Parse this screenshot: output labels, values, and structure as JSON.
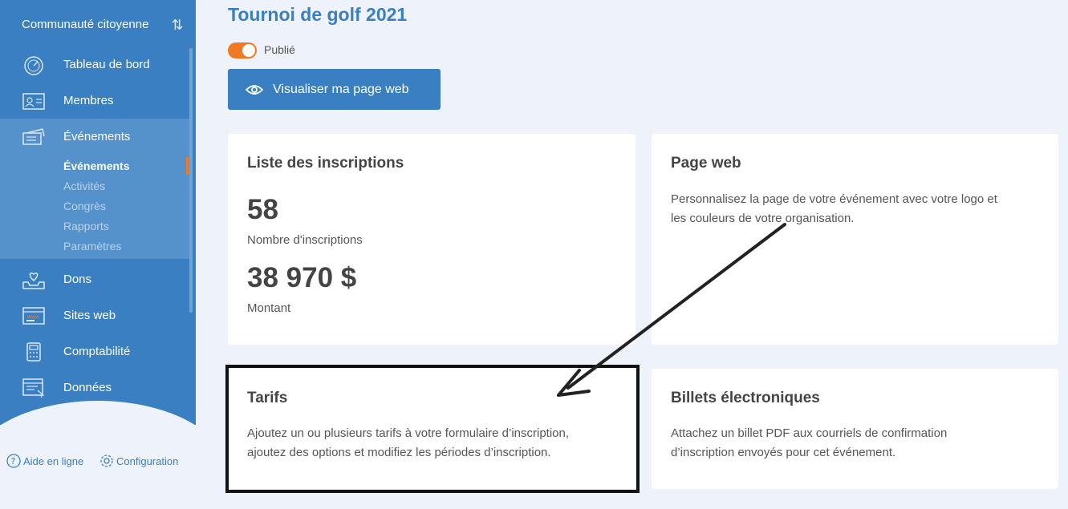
{
  "sidebar": {
    "org_name": "Communauté citoyenne",
    "items": [
      {
        "label": "Tableau de bord",
        "icon": "dashboard-gauge-icon"
      },
      {
        "label": "Membres",
        "icon": "members-card-icon"
      },
      {
        "label": "Événements",
        "icon": "tickets-icon"
      },
      {
        "label": "Dons",
        "icon": "donation-heart-icon"
      },
      {
        "label": "Sites web",
        "icon": "website-icon"
      },
      {
        "label": "Comptabilité",
        "icon": "calculator-icon"
      },
      {
        "label": "Données",
        "icon": "data-report-icon"
      }
    ],
    "subitems": [
      "Événements",
      "Activités",
      "Congrès",
      "Rapports",
      "Paramètres"
    ],
    "help_label": "Aide en ligne",
    "config_label": "Configuration"
  },
  "main": {
    "title": "Tournoi de golf 2021",
    "published_label": "Publié",
    "view_button": "Visualiser ma page web",
    "cards": {
      "registrations": {
        "title": "Liste des inscriptions",
        "count": "58",
        "count_label": "Nombre d'inscriptions",
        "amount": "38 970 $",
        "amount_label": "Montant"
      },
      "webpage": {
        "title": "Page web",
        "text_line1": "Personnalisez la page de votre événement avec votre logo et",
        "text_line2": "les couleurs de votre organisation."
      },
      "rates": {
        "title": "Tarifs",
        "text_line1": "Ajoutez un ou plusieurs tarifs à votre formulaire d’inscription,",
        "text_line2": "ajoutez des options et modifiez les périodes d’inscription."
      },
      "tickets": {
        "title": "Billets électroniques",
        "text_line1": "Attachez un billet PDF aux courriels de confirmation",
        "text_line2": "d’inscription envoyés pour cet événement."
      }
    }
  },
  "colors": {
    "primary": "#3a7fc1",
    "accent": "#f07a24",
    "background": "#eef3fb"
  }
}
